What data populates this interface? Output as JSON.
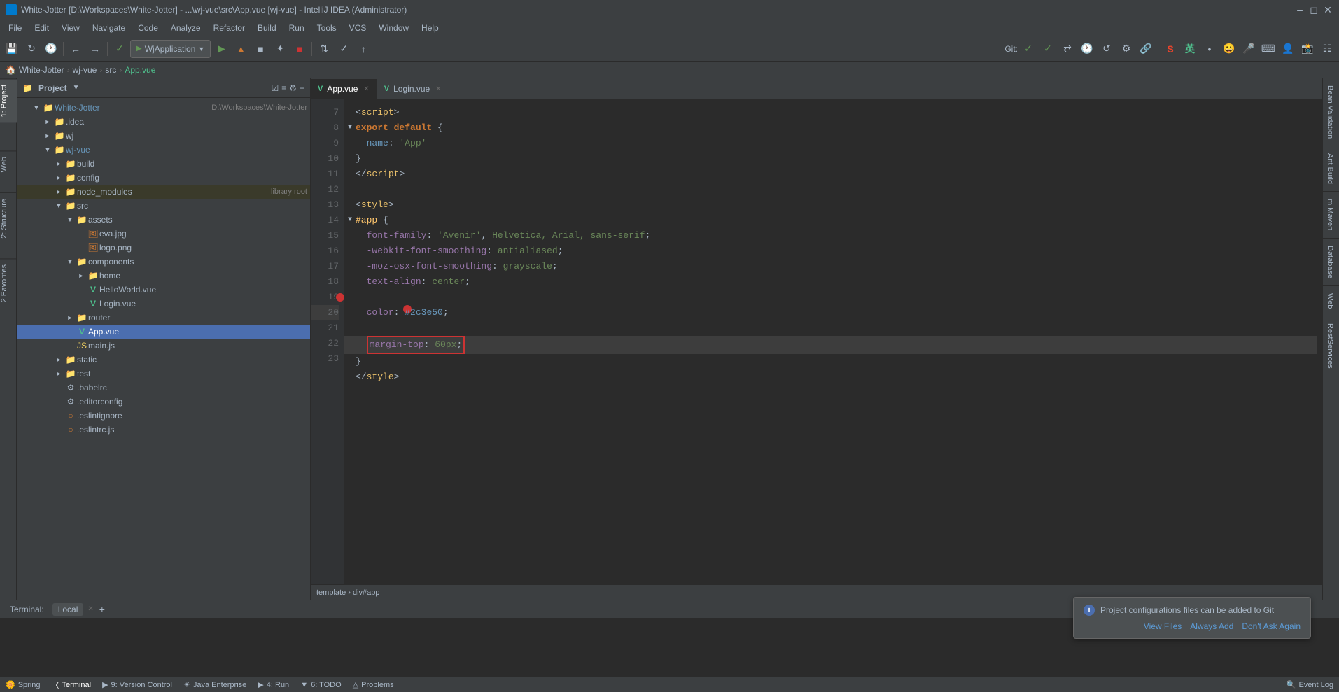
{
  "window": {
    "title": "White-Jotter [D:\\Workspaces\\White-Jotter] - ...\\wj-vue\\src\\App.vue [wj-vue] - IntelliJ IDEA (Administrator)"
  },
  "menubar": {
    "items": [
      "File",
      "Edit",
      "View",
      "Navigate",
      "Code",
      "Analyze",
      "Refactor",
      "Build",
      "Run",
      "Tools",
      "VCS",
      "Window",
      "Help"
    ]
  },
  "toolbar": {
    "run_config": "WjApplication",
    "git_label": "Git:"
  },
  "breadcrumb": {
    "items": [
      "White-Jotter",
      "wj-vue",
      "src",
      "App.vue"
    ]
  },
  "project": {
    "title": "Project",
    "root_name": "White-Jotter",
    "root_path": "D:\\Workspaces\\White-Jotter",
    "items": [
      {
        "id": "idea",
        "label": ".idea",
        "type": "folder",
        "indent": "indent-2",
        "collapsed": true
      },
      {
        "id": "wj",
        "label": "wj",
        "type": "folder",
        "indent": "indent-2",
        "collapsed": true
      },
      {
        "id": "wj-vue",
        "label": "wj-vue",
        "type": "folder",
        "indent": "indent-2",
        "collapsed": false
      },
      {
        "id": "build",
        "label": "build",
        "type": "folder",
        "indent": "indent-3",
        "collapsed": true
      },
      {
        "id": "config",
        "label": "config",
        "type": "folder",
        "indent": "indent-3",
        "collapsed": true
      },
      {
        "id": "node_modules",
        "label": "node_modules",
        "type": "folder",
        "indent": "indent-3",
        "collapsed": true,
        "suffix": "library root"
      },
      {
        "id": "src",
        "label": "src",
        "type": "folder",
        "indent": "indent-3",
        "collapsed": false
      },
      {
        "id": "assets",
        "label": "assets",
        "type": "folder",
        "indent": "indent-4",
        "collapsed": false
      },
      {
        "id": "eva",
        "label": "eva.jpg",
        "type": "img",
        "indent": "indent-5"
      },
      {
        "id": "logo",
        "label": "logo.png",
        "type": "img",
        "indent": "indent-5"
      },
      {
        "id": "components",
        "label": "components",
        "type": "folder",
        "indent": "indent-4",
        "collapsed": false
      },
      {
        "id": "home",
        "label": "home",
        "type": "folder",
        "indent": "indent-5",
        "collapsed": true
      },
      {
        "id": "helloworld",
        "label": "HelloWorld.vue",
        "type": "vue",
        "indent": "indent-5"
      },
      {
        "id": "login",
        "label": "Login.vue",
        "type": "vue",
        "indent": "indent-5"
      },
      {
        "id": "router",
        "label": "router",
        "type": "folder",
        "indent": "indent-4",
        "collapsed": true
      },
      {
        "id": "appvue",
        "label": "App.vue",
        "type": "vue",
        "indent": "indent-4",
        "selected": true
      },
      {
        "id": "mainjs",
        "label": "main.js",
        "type": "js",
        "indent": "indent-4"
      },
      {
        "id": "static",
        "label": "static",
        "type": "folder",
        "indent": "indent-3",
        "collapsed": true
      },
      {
        "id": "test",
        "label": "test",
        "type": "folder",
        "indent": "indent-3",
        "collapsed": true
      },
      {
        "id": "babelrc",
        "label": ".babelrc",
        "type": "config",
        "indent": "indent-3"
      },
      {
        "id": "editorconfig",
        "label": ".editorconfig",
        "type": "config",
        "indent": "indent-3"
      },
      {
        "id": "eslintignore",
        "label": ".eslintignore",
        "type": "eslint",
        "indent": "indent-3"
      },
      {
        "id": "eslintrc",
        "label": ".eslintrc.js",
        "type": "eslint",
        "indent": "indent-3"
      }
    ]
  },
  "tabs": [
    {
      "id": "appvue",
      "label": "App.vue",
      "active": true
    },
    {
      "id": "loginvue",
      "label": "Login.vue",
      "active": false
    }
  ],
  "code_lines": [
    {
      "num": 7,
      "content_html": "<span class='punct'>&lt;</span><span class='tag'>script</span><span class='punct'>&gt;</span>",
      "fold": false
    },
    {
      "num": 8,
      "content_html": "<span class='kw'>export default</span> <span class='punct'>{</span>",
      "fold": true
    },
    {
      "num": 9,
      "content_html": "  <span class='prop'>name</span><span class='punct'>: </span><span class='str'>'App'</span>",
      "fold": false
    },
    {
      "num": 10,
      "content_html": "<span class='punct'>}</span>",
      "fold": false
    },
    {
      "num": 11,
      "content_html": "<span class='punct'>&lt;/</span><span class='tag'>script</span><span class='punct'>&gt;</span>",
      "fold": false
    },
    {
      "num": 12,
      "content_html": "",
      "fold": false
    },
    {
      "num": 13,
      "content_html": "<span class='punct'>&lt;</span><span class='tag'>style</span><span class='punct'>&gt;</span>",
      "fold": false
    },
    {
      "num": 14,
      "content_html": "<span class='id-sel'>#app</span> <span class='punct'>{</span>",
      "fold": true
    },
    {
      "num": 15,
      "content_html": "  <span class='css-prop'>font-family</span><span class='punct'>: </span><span class='str'>'Avenir'</span><span class='punct'>, </span><span class='css-val'>Helvetica, Arial, sans-serif</span><span class='punct'>;</span>",
      "fold": false
    },
    {
      "num": 16,
      "content_html": "  <span class='css-prop'>-webkit-font-smoothing</span><span class='punct'>: </span><span class='css-val'>antialiased</span><span class='punct'>;</span>",
      "fold": false
    },
    {
      "num": 17,
      "content_html": "  <span class='css-prop'>-moz-osx-font-smoothing</span><span class='punct'>: </span><span class='css-val'>grayscale</span><span class='punct'>;</span>",
      "fold": false
    },
    {
      "num": 18,
      "content_html": "  <span class='css-prop'>text-align</span><span class='punct'>: </span><span class='css-val'>center</span><span class='punct'>;</span>",
      "fold": false
    },
    {
      "num": 19,
      "content_html": "  <span class='css-prop'>color</span><span class='punct'>: </span><span class='hash-val'>#2c3e50</span><span class='punct'>;</span>",
      "fold": false,
      "breakpoint": true
    },
    {
      "num": 20,
      "content_html": "  <span class='red-box'><span class='css-prop'>margin-top</span><span class='punct'>: </span><span class='css-val'>60px</span><span class='punct'>;</span></span>",
      "fold": false,
      "highlighted": true
    },
    {
      "num": 21,
      "content_html": "<span class='punct'>}</span>",
      "fold": false
    },
    {
      "num": 22,
      "content_html": "<span class='punct'>&lt;/</span><span class='tag'>style</span><span class='punct'>&gt;</span>",
      "fold": false
    },
    {
      "num": 23,
      "content_html": "",
      "fold": false
    }
  ],
  "editor_footer": {
    "path": "template › div#app"
  },
  "right_tabs": [
    "Bean Validation",
    "Ant Build",
    "Maven",
    "Database",
    "Web",
    "RestServices"
  ],
  "bottom_tabs": [
    "Terminal",
    "9: Version Control",
    "Java Enterprise",
    "4: Run",
    "6: TODO",
    "Problems"
  ],
  "terminal": {
    "label": "Local",
    "active": true
  },
  "notification": {
    "text": "Project configurations files can be added to Git",
    "actions": [
      "View Files",
      "Always Add",
      "Don't Ask Again"
    ]
  },
  "status_bar": {
    "items": [
      "Spring",
      "Terminal",
      "9: Version Control",
      "Java Enterprise",
      "4: Run",
      "6: TODO",
      "Problems",
      "Event Log"
    ]
  }
}
